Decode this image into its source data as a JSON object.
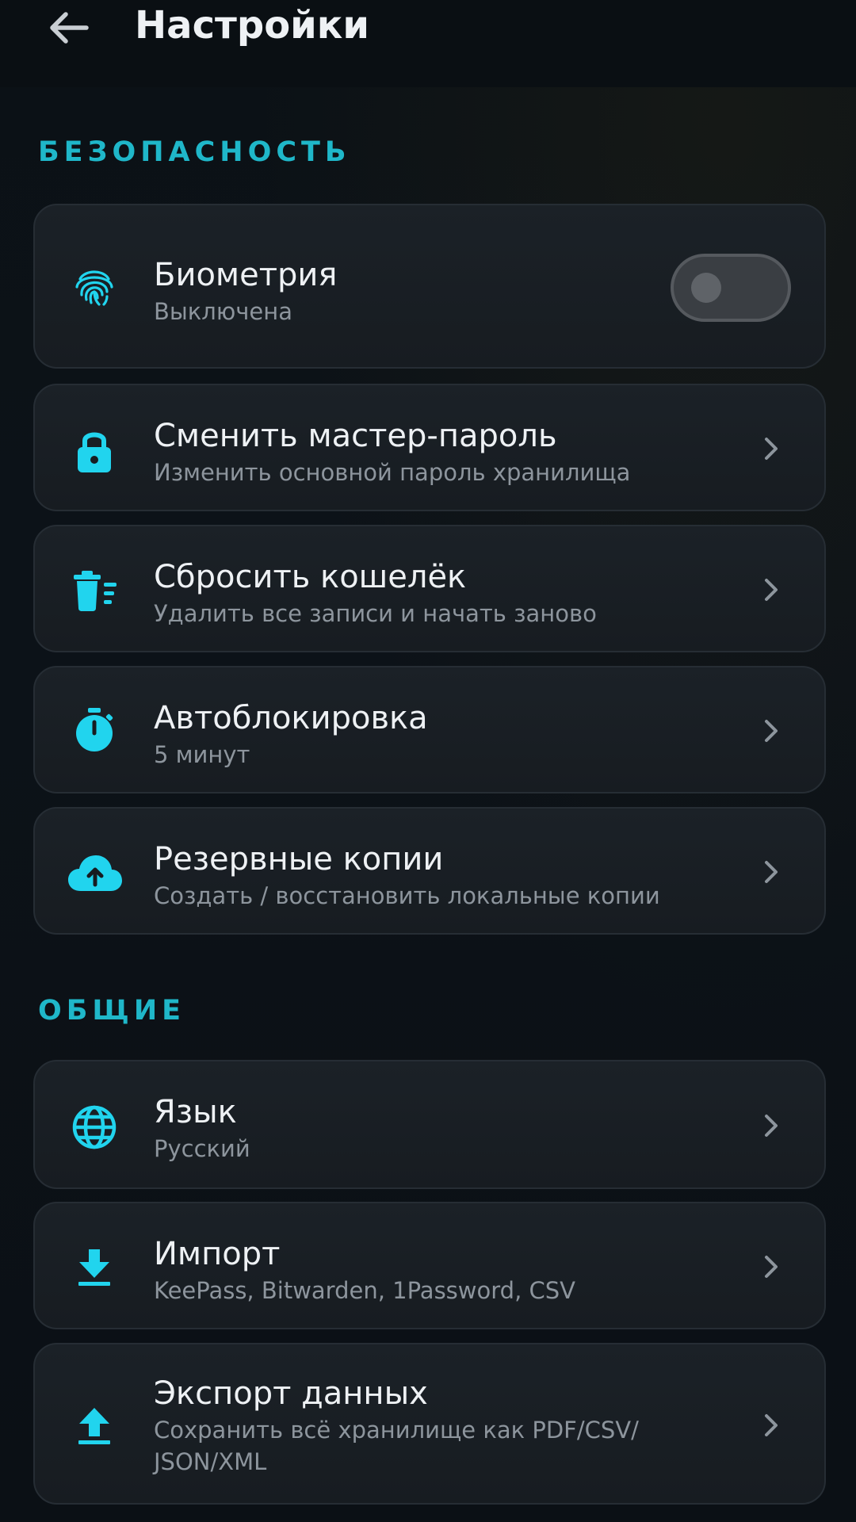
{
  "header": {
    "title": "Настройки",
    "back_icon": "arrow-back-icon"
  },
  "colors": {
    "accent": "#1fb7c9",
    "icon": "#21d4ee",
    "background": "#0b1116",
    "card": "#1a1f24",
    "text_primary": "#eef1f4",
    "text_secondary": "#8d959d"
  },
  "sections": {
    "security": {
      "title": "БЕЗОПАСНОСТЬ",
      "items": [
        {
          "title": "Биометрия",
          "subtitle": "Выключена",
          "icon": "fingerprint-icon",
          "toggle": false
        },
        {
          "title": "Сменить мастер-пароль",
          "subtitle": "Изменить основной пароль хранилища",
          "icon": "lock-icon"
        },
        {
          "title": "Сбросить кошелёк",
          "subtitle": "Удалить все записи и начать заново",
          "icon": "delete-sweep-icon"
        },
        {
          "title": "Автоблокировка",
          "subtitle": "5 минут",
          "icon": "timer-icon"
        },
        {
          "title": "Резервные копии",
          "subtitle": "Создать / восстановить локальные копии",
          "icon": "cloud-upload-icon"
        }
      ]
    },
    "general": {
      "title": "ОБЩИЕ",
      "items": [
        {
          "title": "Язык",
          "subtitle": "Русский",
          "icon": "globe-icon"
        },
        {
          "title": "Импорт",
          "subtitle": "KeePass, Bitwarden, 1Password, CSV",
          "icon": "download-icon"
        },
        {
          "title": "Экспорт данных",
          "subtitle": "Сохранить всё хранилище как PDF/CSV/ JSON/XML",
          "icon": "upload-icon"
        }
      ]
    }
  }
}
